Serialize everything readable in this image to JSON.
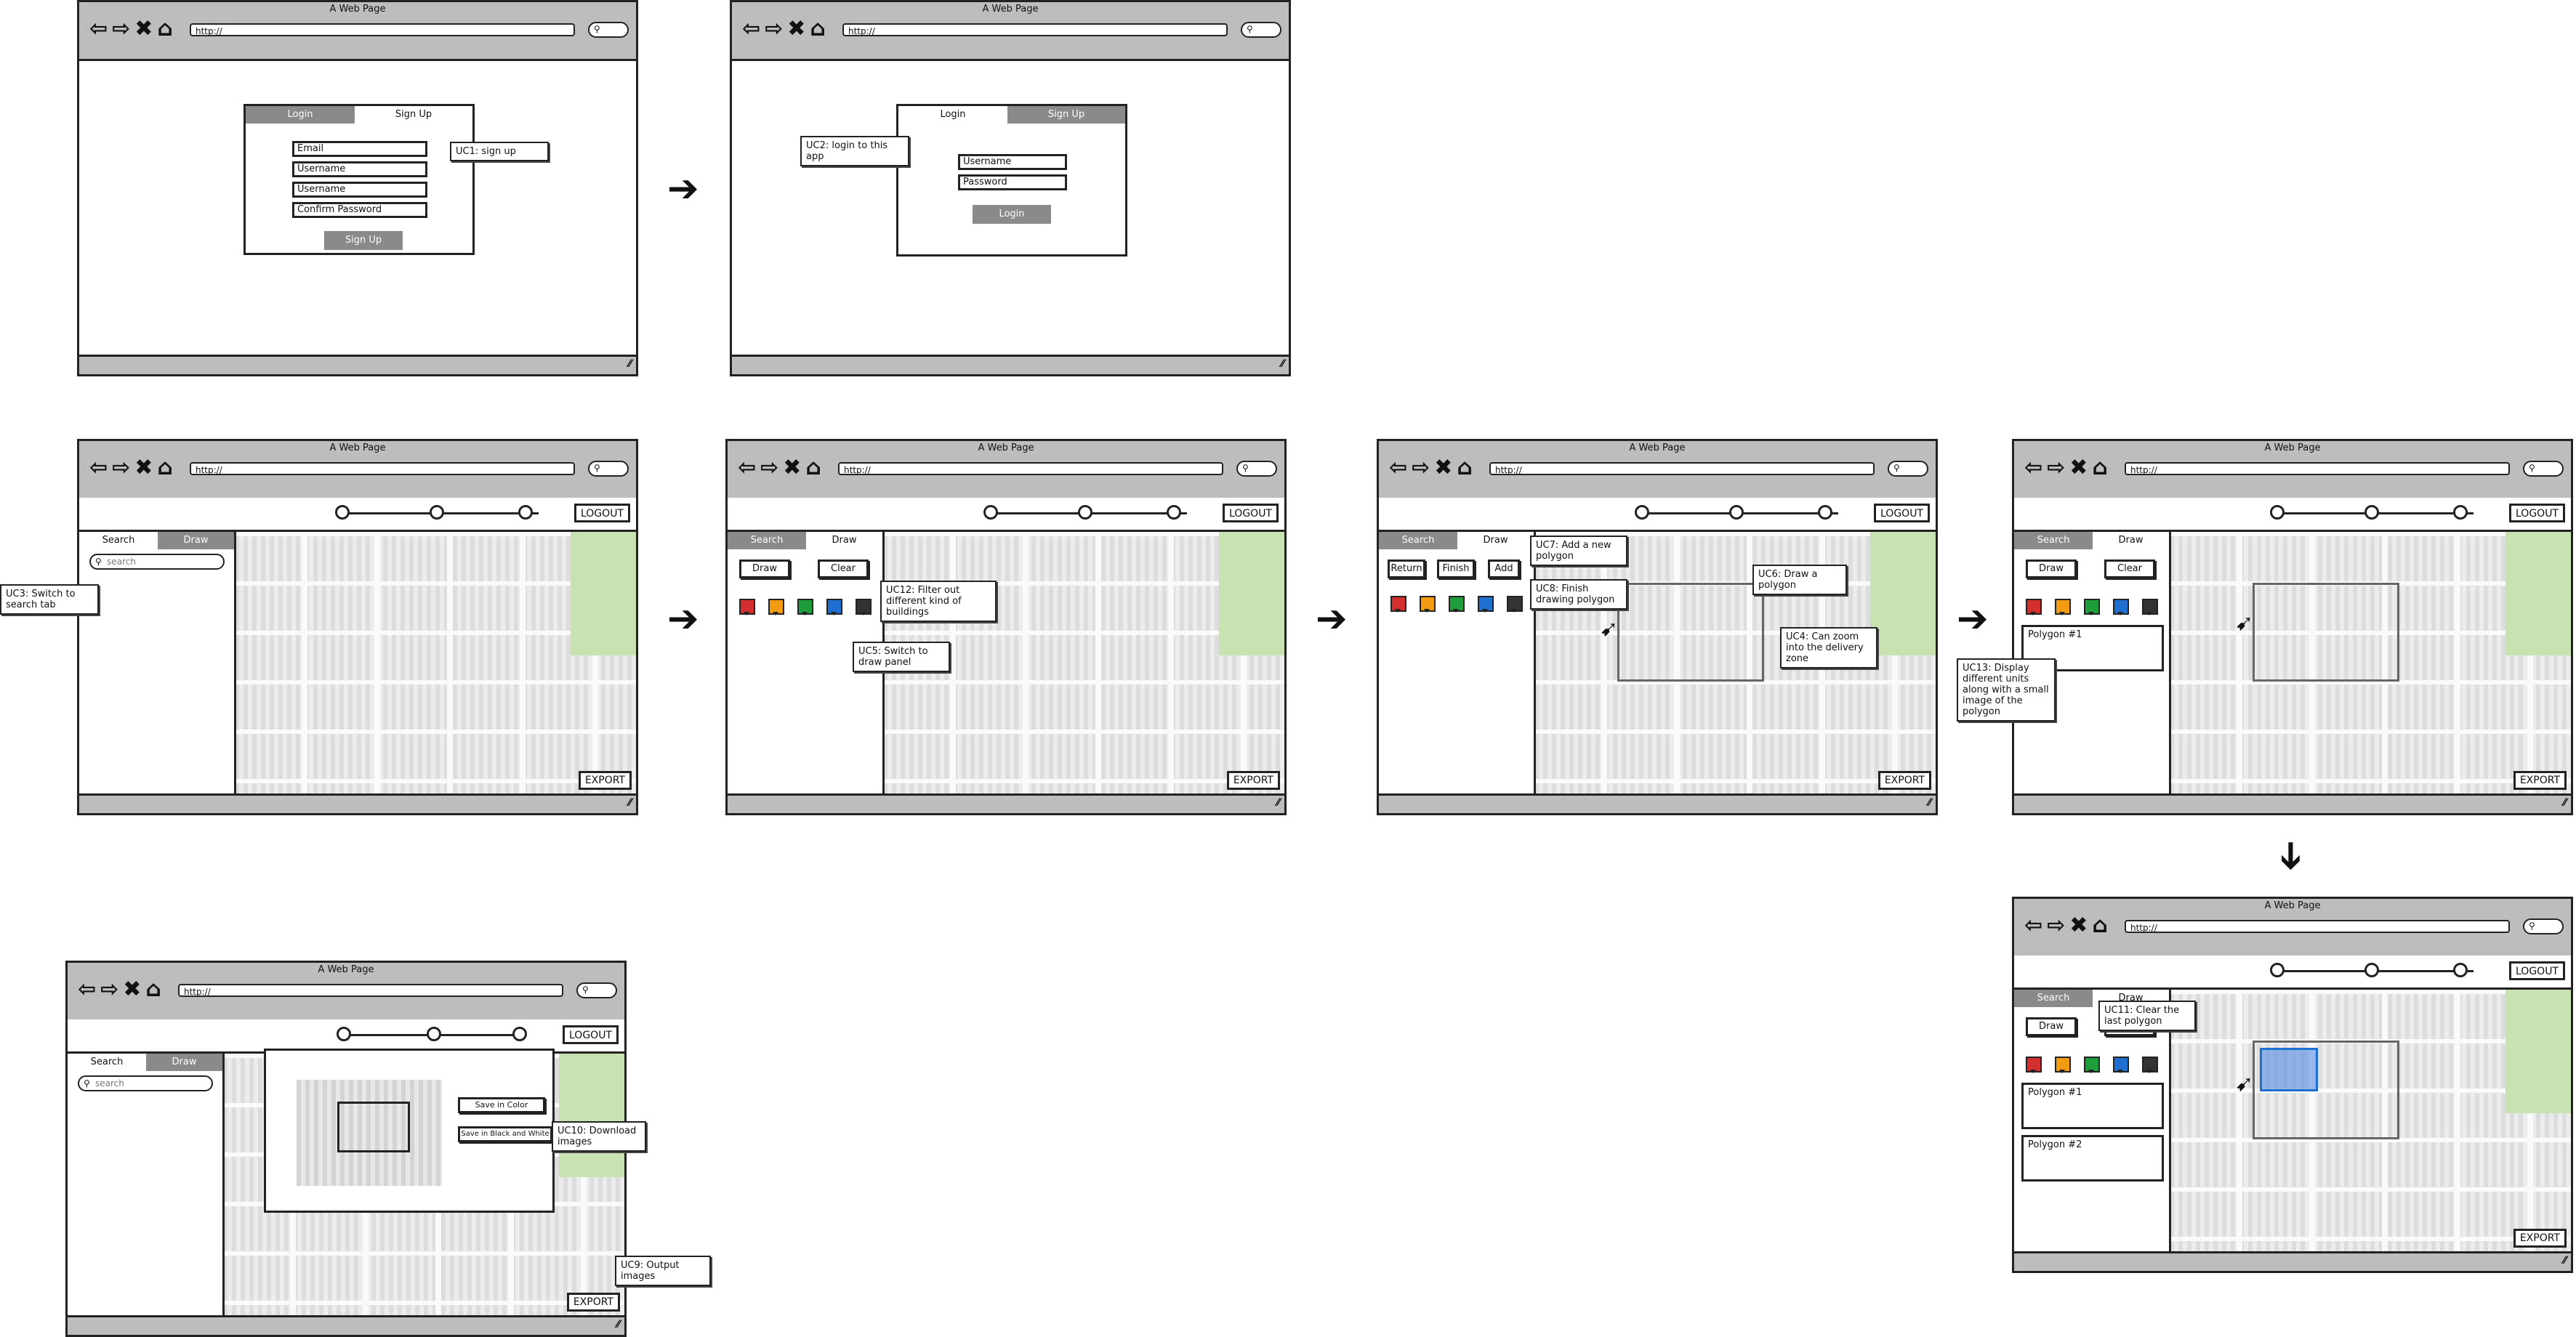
{
  "browser": {
    "title": "A Web Page",
    "url": "http://",
    "nav_icons": [
      "back-icon",
      "forward-icon",
      "close-icon",
      "home-icon"
    ]
  },
  "toolbar": {
    "logout": "LOGOUT",
    "export": "EXPORT"
  },
  "tabs": {
    "search": "Search",
    "draw": "Draw",
    "login": "Login",
    "signup": "Sign Up"
  },
  "search": {
    "placeholder": "search"
  },
  "draw_panel": {
    "draw": "Draw",
    "clear": "Clear",
    "return": "Return",
    "finish": "Finish",
    "add": "Add",
    "colors": [
      "#d32f2f",
      "#f39c12",
      "#1e9e3a",
      "#1f6fd1",
      "#333333"
    ]
  },
  "signup_form": {
    "email": "Email",
    "username1": "Username",
    "username2": "Username",
    "confirm": "Confirm Password",
    "submit": "Sign Up"
  },
  "login_form": {
    "username": "Username",
    "password": "Password",
    "submit": "Login"
  },
  "polygons": {
    "p1": "Polygon #1",
    "p2": "Polygon #2"
  },
  "export_dialog": {
    "color": "Save in Color",
    "bw": "Save in Black and White"
  },
  "notes": {
    "uc1": "UC1: sign up",
    "uc2": "UC2: login to this app",
    "uc3": "UC3: Switch to search tab",
    "uc12": "UC12: Filter out different kind of buildings",
    "uc5": "UC5: Switch to draw panel",
    "uc7": "UC7: Add a new polygon",
    "uc8": "UC8: Finish drawing polygon",
    "uc6": "UC6: Draw a polygon",
    "uc4": "UC4: Can zoom into the delivery zone",
    "uc13": "UC13: Display different units along with a small image of the polygon",
    "uc11": "UC11: Clear the last polygon",
    "uc10": "UC10: Download images",
    "uc9": "UC9: Output images"
  }
}
